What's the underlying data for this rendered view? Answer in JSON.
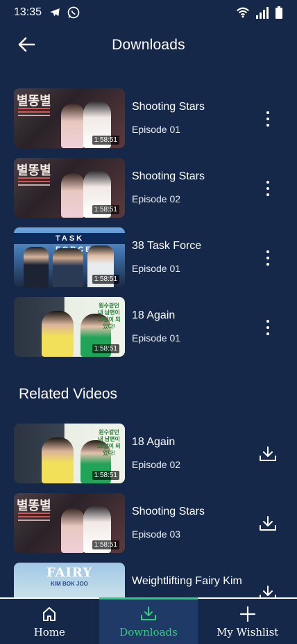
{
  "status_bar": {
    "time": "13:35",
    "left_icons": [
      "telegram-icon",
      "whatsapp-icon"
    ],
    "right_icons": [
      "wifi-icon",
      "signal-icon",
      "battery-icon"
    ]
  },
  "header": {
    "title": "Downloads",
    "back_icon": "arrow-left-icon"
  },
  "downloads": [
    {
      "title": "Shooting Stars",
      "episode": "Episode 01",
      "duration": "1:58:51",
      "thumb": "shooting-stars"
    },
    {
      "title": "Shooting Stars",
      "episode": "Episode 02",
      "duration": "1:58:51",
      "thumb": "shooting-stars"
    },
    {
      "title": "38 Task Force",
      "episode": "Episode 01",
      "duration": "1:58:51",
      "thumb": "task-force"
    },
    {
      "title": "18 Again",
      "episode": "Episode 01",
      "duration": "1:58:51",
      "thumb": "18-again"
    }
  ],
  "related": {
    "title": "Related Videos",
    "items": [
      {
        "title": "18 Again",
        "episode": "Episode 02",
        "duration": "1:58:51",
        "thumb": "18-again"
      },
      {
        "title": "Shooting Stars",
        "episode": "Episode 03",
        "duration": "1:58:51",
        "thumb": "shooting-stars"
      },
      {
        "title": "Weightlifting Fairy Kim",
        "episode": "",
        "duration": "",
        "thumb": "weightlifting-fairy"
      }
    ]
  },
  "thumb_text": {
    "task_force_banner": "TASK FORCE",
    "eighteen_again_caption": "원수같던 내 남편이 18살이 되었다!",
    "shooting_stars_logo": "별똥별",
    "weightlifting_title": "FAIRY",
    "weightlifting_sub": "KIM BOK JOO"
  },
  "bottom_nav": {
    "items": [
      {
        "label": "Home",
        "icon": "home-icon",
        "active": false
      },
      {
        "label": "Downloads",
        "icon": "download-icon",
        "active": true
      },
      {
        "label": "My Wishlist",
        "icon": "plus-icon",
        "active": false
      }
    ]
  },
  "colors": {
    "background": "#16284a",
    "accent": "#2ed17a",
    "nav_active_bg": "#1f3a66"
  }
}
